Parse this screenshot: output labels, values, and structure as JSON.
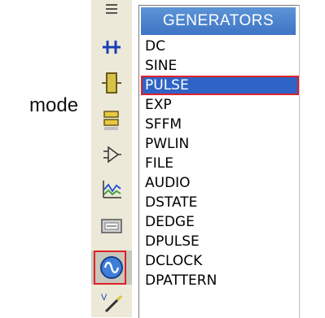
{
  "caption": "mode",
  "panel": {
    "title": "GENERATORS",
    "selected_index": 2,
    "items": [
      {
        "label": "DC"
      },
      {
        "label": "SINE"
      },
      {
        "label": "PULSE"
      },
      {
        "label": "EXP"
      },
      {
        "label": "SFFM"
      },
      {
        "label": "PWLIN"
      },
      {
        "label": "FILE"
      },
      {
        "label": "AUDIO"
      },
      {
        "label": "DSTATE"
      },
      {
        "label": "DEDGE"
      },
      {
        "label": "DPULSE"
      },
      {
        "label": "DCLOCK"
      },
      {
        "label": "DPATTERN"
      }
    ]
  },
  "toolbar": {
    "tools": [
      {
        "name": "bus-icon"
      },
      {
        "name": "junction-icon"
      },
      {
        "name": "component-icon"
      },
      {
        "name": "terminal-icon"
      },
      {
        "name": "subcircuit-port-icon"
      },
      {
        "name": "graph-icon"
      },
      {
        "name": "virtual-instrument-icon"
      },
      {
        "name": "generator-icon",
        "selected": true
      },
      {
        "name": "probe-icon"
      }
    ]
  },
  "colors": {
    "header": "#4a82cf",
    "selection": "#2f63c6",
    "highlight": "#e0202a",
    "toolbar": "#ece9d8"
  }
}
